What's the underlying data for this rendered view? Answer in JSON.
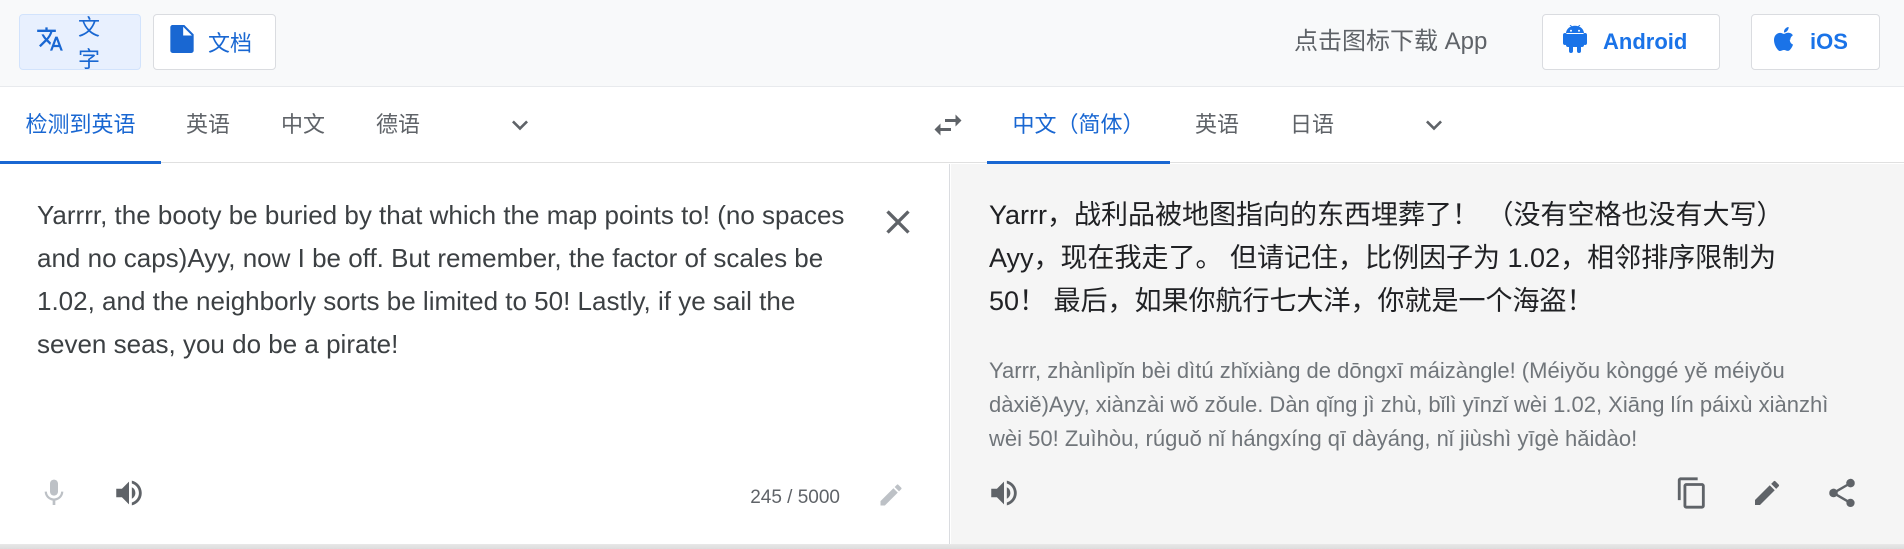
{
  "topbar": {
    "text_mode_label": "文字",
    "docs_mode_label": "文档",
    "download_prompt": "点击图标下载 App",
    "android_label": "Android",
    "ios_label": "iOS"
  },
  "source_langs": {
    "detected_label": "检测到英语",
    "items": [
      "英语",
      "中文",
      "德语"
    ]
  },
  "target_langs": {
    "selected_label": "中文（简体）",
    "items": [
      "英语",
      "日语"
    ]
  },
  "source": {
    "text": "Yarrrr, the booty be buried by that which the map points to! (no spaces and no caps)Ayy, now I be off. But remember, the factor of scales be 1.02, and the neighborly sorts be limited to 50! Lastly, if ye sail the seven seas, you do be a pirate!",
    "char_count": "245 / 5000"
  },
  "target": {
    "text": "Yarrr，战利品被地图指向的东西埋葬了！ （没有空格也没有大写）Ayy，现在我走了。 但请记住，比例因子为 1.02，相邻排序限制为 50！ 最后，如果你航行七大洋，你就是一个海盗！",
    "transliteration": "Yarrr, zhànlìpǐn bèi dìtú zhǐxiàng de dōngxī máizàngle! (Méiyǒu kònggé yě méiyǒu dàxiě)Ayy, xiànzài wǒ zǒule. Dàn qǐng jì zhù, bǐlì yīnzǐ wèi 1.02, Xiāng lín páixù xiànzhì wèi 50! Zuìhòu, rúguǒ nǐ hángxíng qī dàyáng, nǐ jiùshì yīgè hǎidào!"
  },
  "colors": {
    "accent": "#1967d2",
    "icon_gray": "#5f6368",
    "target_bg": "#f5f5f5"
  },
  "icons": [
    "translate-icon",
    "document-icon",
    "android-icon",
    "apple-icon",
    "chevron-down-icon",
    "swap-icon",
    "close-icon",
    "microphone-icon",
    "speaker-icon",
    "pencil-icon",
    "copy-icon",
    "share-icon"
  ]
}
